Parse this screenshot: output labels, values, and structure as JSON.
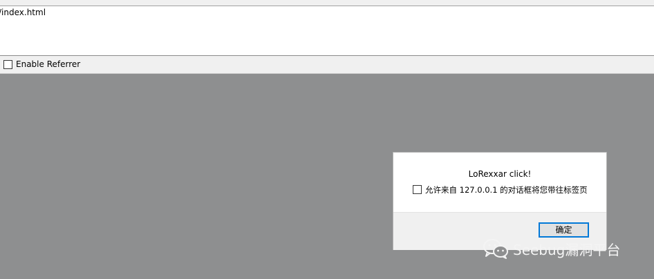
{
  "address_bar": {
    "url": "/index.html"
  },
  "options": {
    "enable_referrer_label": "Enable Referrer",
    "enable_referrer_checked": false
  },
  "dialog": {
    "message": "LoRexxar click!",
    "prevent_checkbox_label": "允许来自 127.0.0.1 的对话框将您带往标签页",
    "prevent_checked": false,
    "ok_label": "确定"
  },
  "watermark": {
    "text": "Seebug漏洞平台",
    "icon": "wechat-icon"
  },
  "colors": {
    "overlay": "#8e8f90",
    "button_focus_border": "#0078d7"
  }
}
